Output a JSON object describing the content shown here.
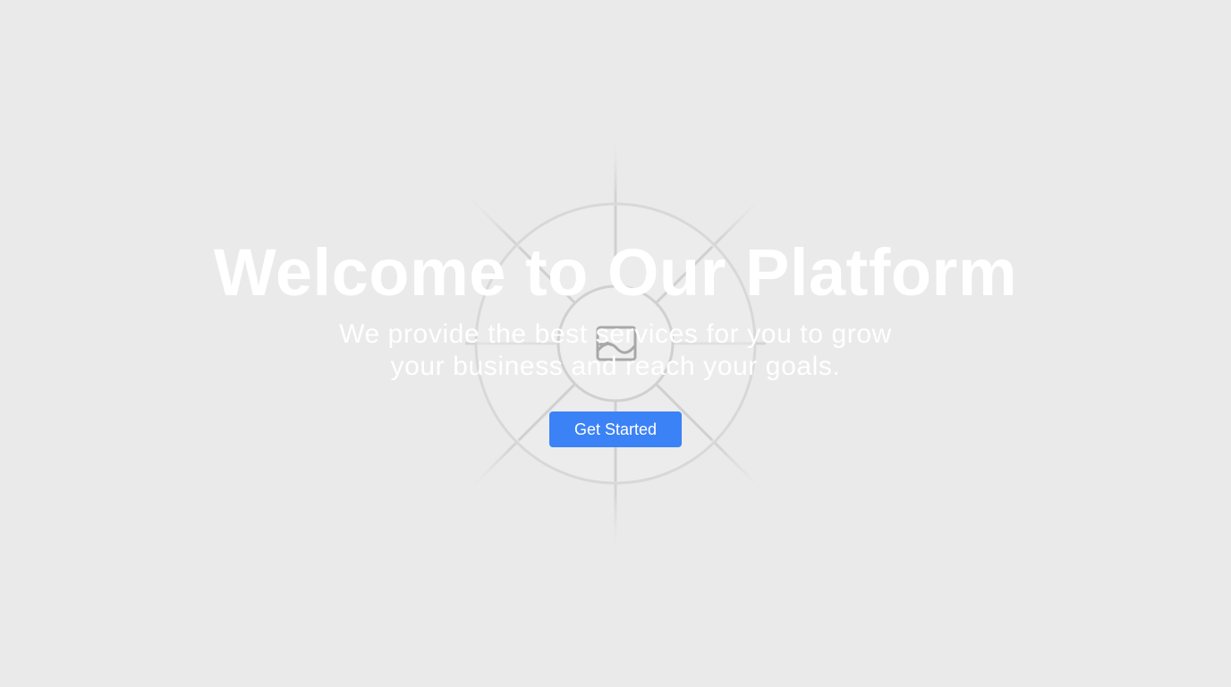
{
  "hero": {
    "title": "Welcome to Our Platform",
    "subtitle_line1": "We provide the best services for you to grow",
    "subtitle_line2": "your business and reach your goals.",
    "cta_label": "Get Started",
    "background_image": {
      "icon": "image-placeholder-icon"
    }
  },
  "colors": {
    "background": "#eaeaea",
    "text": "#ffffff",
    "accent": "#3b82f6"
  }
}
